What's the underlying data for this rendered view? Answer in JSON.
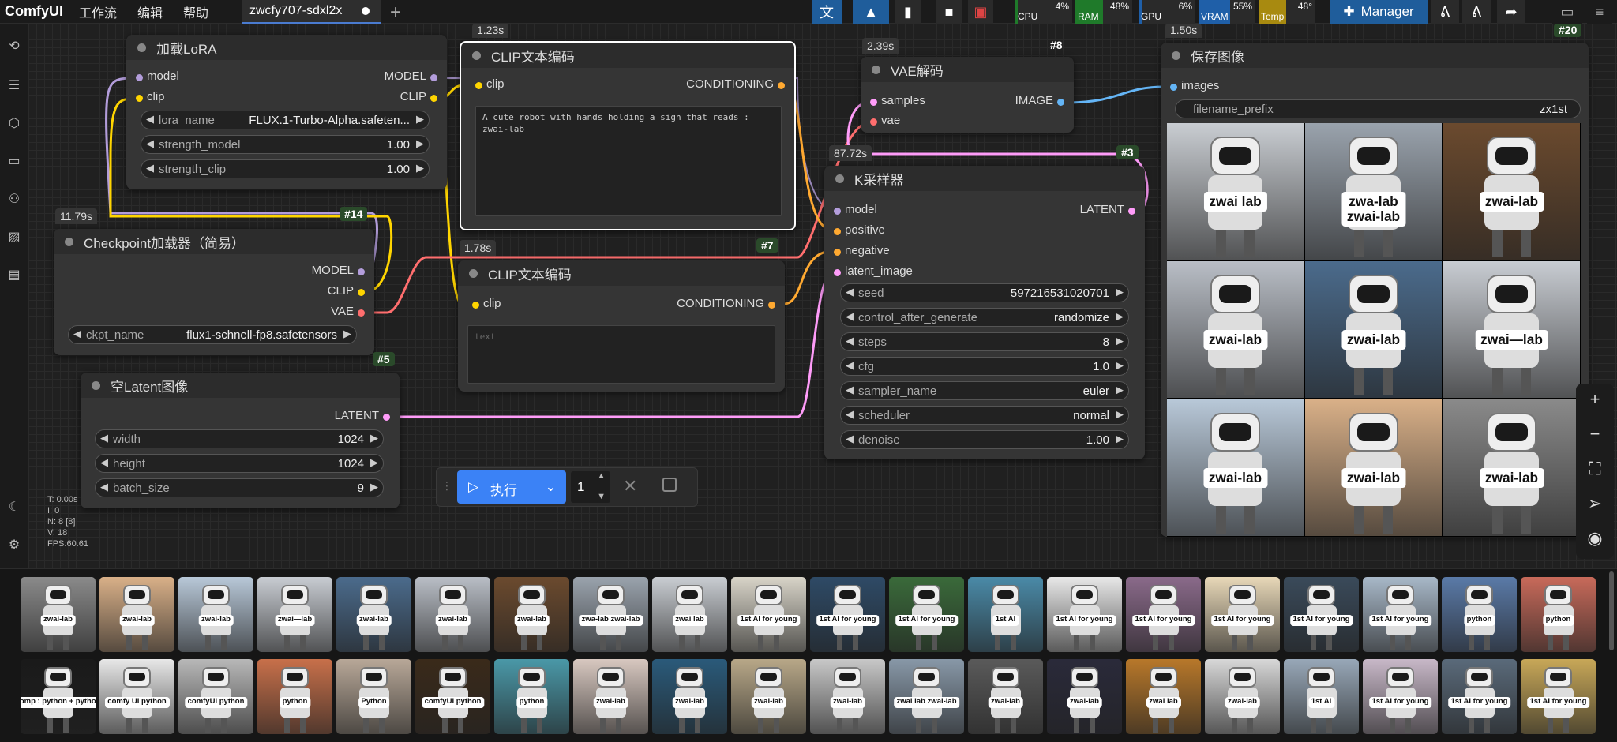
{
  "app": {
    "name": "ComfyUI"
  },
  "menu": [
    "工作流",
    "编辑",
    "帮助"
  ],
  "tab": {
    "label": "zwcfy707-sdxl2x"
  },
  "toolbar": {
    "manager_label": "Manager"
  },
  "meters": [
    {
      "label": "CPU",
      "pct": "4%",
      "fill": 0.04,
      "color": "#2a2a2a"
    },
    {
      "label": "RAM",
      "pct": "48%",
      "fill": 0.48,
      "color": "#1f7a2a"
    },
    {
      "label": "GPU",
      "pct": "6%",
      "fill": 0.06,
      "color": "#2a2a2a"
    },
    {
      "label": "VRAM",
      "pct": "55%",
      "fill": 0.55,
      "color": "#1f5fa8"
    },
    {
      "label": "Temp",
      "pct": "48°",
      "fill": 0.48,
      "color": "#a88a10"
    }
  ],
  "nodes": {
    "lora": {
      "title": "加载LoRA",
      "in_model": "model",
      "in_clip": "clip",
      "out_model": "MODEL",
      "out_clip": "CLIP",
      "widgets": [
        {
          "label": "lora_name",
          "value": "FLUX.1-Turbo-Alpha.safeten..."
        },
        {
          "label": "strength_model",
          "value": "1.00"
        },
        {
          "label": "strength_clip",
          "value": "1.00"
        }
      ]
    },
    "ckpt": {
      "title": "Checkpoint加载器（简易）",
      "time": "11.79s",
      "id": "#14",
      "id2": "#5",
      "out_model": "MODEL",
      "out_clip": "CLIP",
      "out_vae": "VAE",
      "widget": {
        "label": "ckpt_name",
        "value": "flux1-schnell-fp8.safetensors"
      }
    },
    "latent": {
      "title": "空Latent图像",
      "out": "LATENT",
      "widgets": [
        {
          "label": "width",
          "value": "1024"
        },
        {
          "label": "height",
          "value": "1024"
        },
        {
          "label": "batch_size",
          "value": "9"
        }
      ]
    },
    "clip1": {
      "title": "CLIP文本编码",
      "time": "1.23s",
      "in_clip": "clip",
      "out": "CONDITIONING",
      "text": "A cute robot with hands holding a sign that reads :\nzwai-lab"
    },
    "clip2": {
      "title": "CLIP文本编码",
      "time": "1.78s",
      "id": "#7",
      "in_clip": "clip",
      "out": "CONDITIONING",
      "placeholder": "text"
    },
    "vae": {
      "title": "VAE解码",
      "time": "2.39s",
      "id": "#8",
      "in_samples": "samples",
      "in_vae": "vae",
      "out": "IMAGE"
    },
    "ksampler": {
      "title": "K采样器",
      "time": "87.72s",
      "id": "#3",
      "in_model": "model",
      "in_positive": "positive",
      "in_negative": "negative",
      "in_latent": "latent_image",
      "out": "LATENT",
      "widgets": [
        {
          "label": "seed",
          "value": "597216531020701"
        },
        {
          "label": "control_after_generate",
          "value": "randomize"
        },
        {
          "label": "steps",
          "value": "8"
        },
        {
          "label": "cfg",
          "value": "1.0"
        },
        {
          "label": "sampler_name",
          "value": "euler"
        },
        {
          "label": "scheduler",
          "value": "normal"
        },
        {
          "label": "denoise",
          "value": "1.00"
        }
      ]
    },
    "save": {
      "title": "保存图像",
      "time": "1.50s",
      "id": "#20",
      "in_images": "images",
      "widget": {
        "label": "filename_prefix",
        "value": "zx1st"
      },
      "images": [
        {
          "sign": "zwai lab",
          "bg": "#c9cdd2"
        },
        {
          "sign": "zwa-lab\nzwai-lab",
          "bg": "#9aa3ad"
        },
        {
          "sign": "zwai-lab",
          "bg": "#6b4a2e"
        },
        {
          "sign": "zwai-lab",
          "bg": "#b9bec6"
        },
        {
          "sign": "zwai-lab",
          "bg": "#4b6b8c"
        },
        {
          "sign": "zwai—lab",
          "bg": "#c8ccd2"
        },
        {
          "sign": "zwai-lab",
          "bg": "#b8c8d8"
        },
        {
          "sign": "zwai-lab",
          "bg": "#d9b088"
        },
        {
          "sign": "zwai-lab",
          "bg": "#8a8a8a"
        }
      ]
    }
  },
  "run": {
    "label": "执行",
    "count": "1"
  },
  "stats": [
    "T: 0.00s",
    "I: 0",
    "N: 8 [8]",
    "V: 18",
    "FPS:60.61"
  ],
  "gallery": {
    "row1": [
      {
        "sign": "zwai-lab",
        "bg": "#8a8a8a"
      },
      {
        "sign": "zwai-lab",
        "bg": "#d9b088"
      },
      {
        "sign": "zwai-lab",
        "bg": "#b8c8d8"
      },
      {
        "sign": "zwai—lab",
        "bg": "#c8ccd2"
      },
      {
        "sign": "zwai-lab",
        "bg": "#4b6b8c"
      },
      {
        "sign": "zwai-lab",
        "bg": "#b9bec6"
      },
      {
        "sign": "zwai-lab",
        "bg": "#6b4a2e"
      },
      {
        "sign": "zwa-lab zwai-lab",
        "bg": "#9aa3ad"
      },
      {
        "sign": "zwai lab",
        "bg": "#c9cdd2"
      },
      {
        "sign": "1st AI for young",
        "bg": "#d8d4c8"
      },
      {
        "sign": "1st AI for young",
        "bg": "#2e4a66"
      },
      {
        "sign": "1st AI for young",
        "bg": "#3a6a3a"
      },
      {
        "sign": "1st AI",
        "bg": "#4a8aa8"
      },
      {
        "sign": "1st AI for young",
        "bg": "#e8e8e8"
      },
      {
        "sign": "1st AI for young",
        "bg": "#8a6a8a"
      },
      {
        "sign": "1st AI for young",
        "bg": "#e8d8b8"
      },
      {
        "sign": "1st AI for young",
        "bg": "#3a4a5a"
      },
      {
        "sign": "1st AI for young",
        "bg": "#a8b8c8"
      },
      {
        "sign": "python",
        "bg": "#5a7aa8"
      },
      {
        "sign": "python",
        "bg": "#c86a5a"
      }
    ],
    "row2": [
      {
        "sign": "comp : python + python",
        "bg": "#1a1a1a"
      },
      {
        "sign": "comfy UI python",
        "bg": "#e8e8e8"
      },
      {
        "sign": "comfyUI python",
        "bg": "#b8b8b8"
      },
      {
        "sign": "python",
        "bg": "#c8704a"
      },
      {
        "sign": "Python",
        "bg": "#b8a898"
      },
      {
        "sign": "comfyUI python",
        "bg": "#3a2a1a"
      },
      {
        "sign": "python",
        "bg": "#4a98a8"
      },
      {
        "sign": "zwai-lab",
        "bg": "#d8c8c0"
      },
      {
        "sign": "zwai-lab",
        "bg": "#2a5a7a"
      },
      {
        "sign": "zwai-lab",
        "bg": "#b8a888"
      },
      {
        "sign": "zwai-lab",
        "bg": "#c8c8c8"
      },
      {
        "sign": "zwai lab zwai-lab",
        "bg": "#8898a8"
      },
      {
        "sign": "zwai-lab",
        "bg": "#5a5a5a"
      },
      {
        "sign": "zwai-lab",
        "bg": "#2a2a3a"
      },
      {
        "sign": "zwai lab",
        "bg": "#b8782a"
      },
      {
        "sign": "zwai-lab",
        "bg": "#d8d8d8"
      },
      {
        "sign": "1st AI",
        "bg": "#98a8b8"
      },
      {
        "sign": "1st AI for young",
        "bg": "#c8b8c8"
      },
      {
        "sign": "1st AI for young",
        "bg": "#5a6a7a"
      },
      {
        "sign": "1st AI for young",
        "bg": "#c8a858"
      }
    ]
  },
  "colors": {
    "model": "#b39ddb",
    "clip": "#ffd500",
    "vae": "#ff6e6e",
    "conditioning": "#ffa931",
    "latent": "#ff9cf9",
    "image": "#64b5f6",
    "accent": "#3b82f6"
  }
}
